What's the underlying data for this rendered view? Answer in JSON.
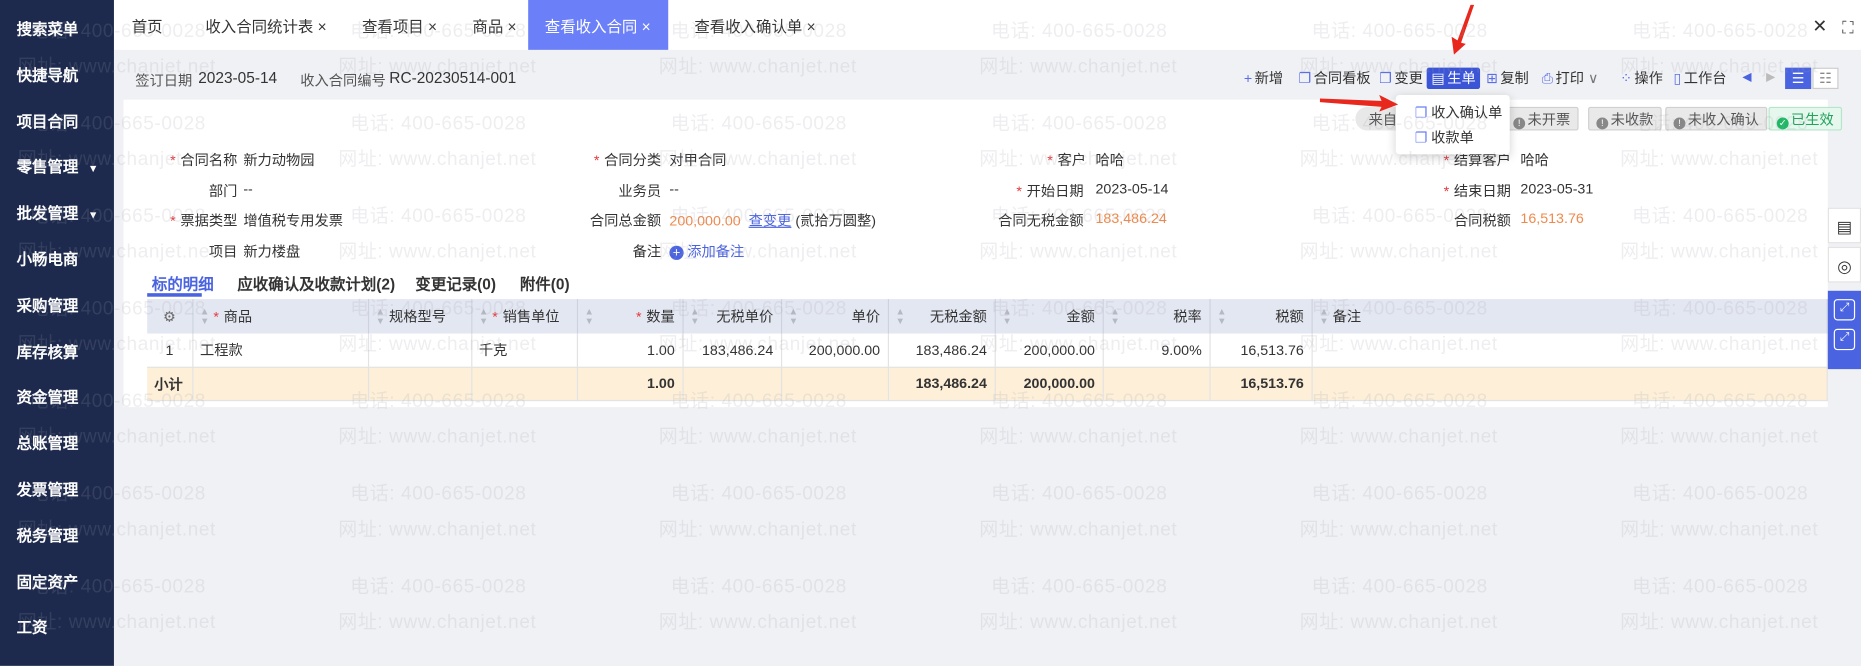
{
  "sidebar": {
    "items": [
      {
        "label": "搜索菜单"
      },
      {
        "label": "快捷导航"
      },
      {
        "label": "项目合同"
      },
      {
        "label": "零售管理",
        "caret": "▼"
      },
      {
        "label": "批发管理",
        "caret": "▼"
      },
      {
        "label": "小畅电商"
      },
      {
        "label": "采购管理"
      },
      {
        "label": "库存核算"
      },
      {
        "label": "资金管理"
      },
      {
        "label": "总账管理"
      },
      {
        "label": "发票管理"
      },
      {
        "label": "税务管理"
      },
      {
        "label": "固定资产"
      },
      {
        "label": "工资"
      }
    ]
  },
  "tabs": [
    {
      "label": "首页"
    },
    {
      "label": "收入合同统计表 ×"
    },
    {
      "label": "查看项目 ×"
    },
    {
      "label": "商品 ×"
    },
    {
      "label": "查看收入合同 ×",
      "active": true
    },
    {
      "label": "查看收入确认单 ×"
    }
  ],
  "window": {
    "close": "✕",
    "fullscreen": "⛶"
  },
  "header": {
    "sign_date_label": "签订日期",
    "sign_date": "2023-05-14",
    "contract_no_label": "收入合同编号",
    "contract_no": "RC-20230514-001"
  },
  "toolbar": {
    "new": "新增",
    "board": "合同看板",
    "change": "变更",
    "generate": "生单",
    "copy": "复制",
    "print": "打印",
    "print_caret": "∨",
    "ops": "操作",
    "workbench": "工作台",
    "prev": "◀",
    "next": "▶"
  },
  "dropdown": {
    "items": [
      "收入确认单",
      "收款单"
    ]
  },
  "source_badge": "来自",
  "status_badges": [
    {
      "label": "未开票"
    },
    {
      "label": "未收款"
    },
    {
      "label": "未收入确认"
    },
    {
      "label": "已生效"
    }
  ],
  "form": {
    "contract_name": {
      "label": "合同名称",
      "value": "新力动物园"
    },
    "contract_type": {
      "label": "合同分类",
      "value": "对甲合同"
    },
    "customer": {
      "label": "客户",
      "value": "哈哈"
    },
    "settle_customer": {
      "label": "结算客户",
      "value": "哈哈"
    },
    "dept": {
      "label": "部门",
      "value": "--"
    },
    "salesman": {
      "label": "业务员",
      "value": "--"
    },
    "start_date": {
      "label": "开始日期",
      "value": "2023-05-14"
    },
    "end_date": {
      "label": "结束日期",
      "value": "2023-05-31"
    },
    "invoice_type": {
      "label": "票据类型",
      "value": "增值税专用发票"
    },
    "total": {
      "label": "合同总金额",
      "value": "200,000.00",
      "link": "查变更",
      "upper": "(贰拾万圆整)"
    },
    "net": {
      "label": "合同无税金额",
      "value": "183,486.24"
    },
    "tax": {
      "label": "合同税额",
      "value": "16,513.76"
    },
    "project": {
      "label": "项目",
      "value": "新力楼盘"
    },
    "remark": {
      "label": "备注",
      "add": "添加备注"
    }
  },
  "subtabs": [
    "标的明细",
    "应收确认及收款计划(2)",
    "变更记录(0)",
    "附件(0)"
  ],
  "table": {
    "headers": [
      "商品",
      "规格型号",
      "销售单位",
      "数量",
      "无税单价",
      "单价",
      "无税金额",
      "金额",
      "税率",
      "税额",
      "备注"
    ],
    "rows": [
      [
        "1",
        "工程款",
        "",
        "千克",
        "1.00",
        "183,486.24",
        "200,000.00",
        "183,486.24",
        "200,000.00",
        "9.00%",
        "16,513.76",
        ""
      ]
    ],
    "subtotal": [
      "小计",
      "",
      "",
      "",
      "1.00",
      "",
      "",
      "183,486.24",
      "200,000.00",
      "",
      "16,513.76",
      ""
    ]
  },
  "watermark": {
    "tel": "电话: 400-665-0028",
    "url": "网址: www.chanjet.net"
  },
  "colors": {
    "sidebar": "#1d2a4d",
    "accent": "#6b80f8",
    "primary": "#4a63e0",
    "amount": "#ef8a4c",
    "subtotal": "#fdefd8"
  }
}
